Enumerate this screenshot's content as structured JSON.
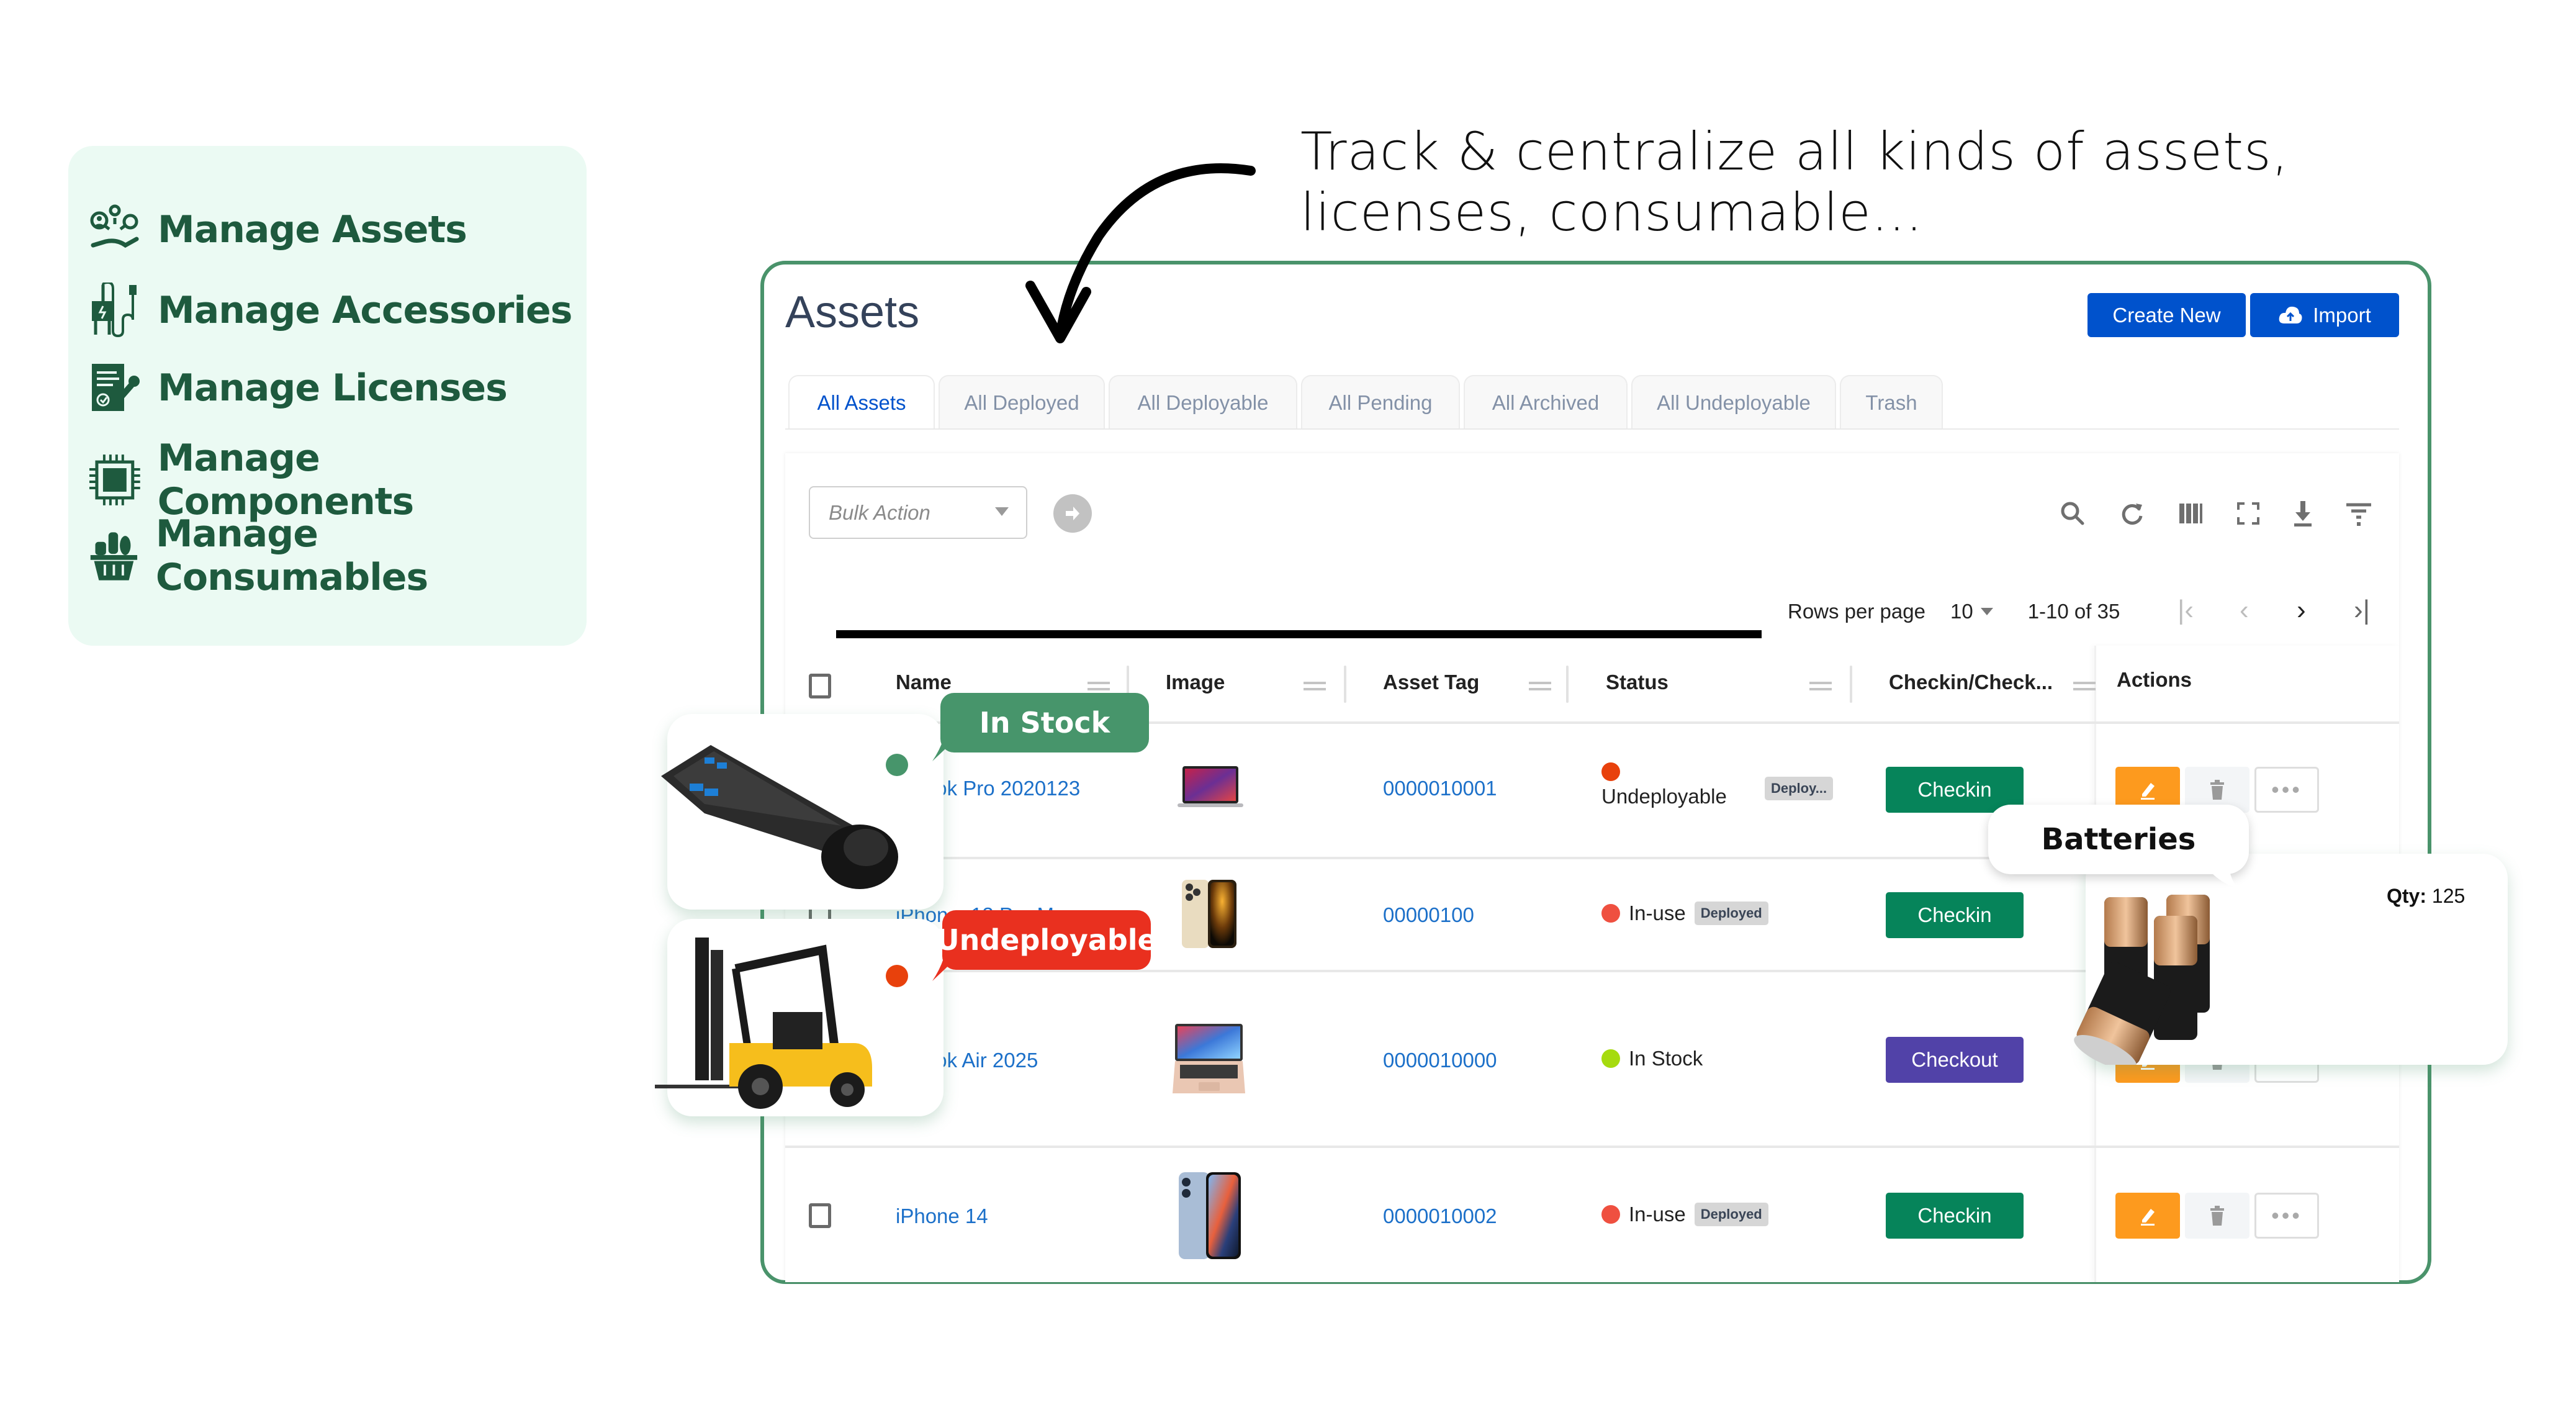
{
  "features": {
    "items": [
      {
        "icon": "hand-assets-icon",
        "label": "Manage Assets"
      },
      {
        "icon": "charger-icon",
        "label": "Manage Accessories"
      },
      {
        "icon": "license-document-icon",
        "label": "Manage Licenses"
      },
      {
        "icon": "chip-icon",
        "label": "Manage Components"
      },
      {
        "icon": "basket-icon",
        "label": "Manage Consumables"
      }
    ]
  },
  "tagline": {
    "line1": "Track & centralize all kinds of assets,",
    "line2": "licenses, consumable..."
  },
  "page": {
    "title": "Assets",
    "create_label": "Create New",
    "import_label": "Import"
  },
  "tabs": [
    {
      "label": "All Assets",
      "active": true
    },
    {
      "label": "All Deployed",
      "active": false
    },
    {
      "label": "All Deployable",
      "active": false
    },
    {
      "label": "All Pending",
      "active": false
    },
    {
      "label": "All Archived",
      "active": false
    },
    {
      "label": "All Undeployable",
      "active": false
    },
    {
      "label": "Trash",
      "active": false
    }
  ],
  "toolbar": {
    "bulk_placeholder": "Bulk Action",
    "icons": [
      "search-icon",
      "refresh-icon",
      "columns-icon",
      "fullscreen-icon",
      "download-icon",
      "filter-icon"
    ]
  },
  "pagination": {
    "rows_per_page_label": "Rows per page",
    "rows_per_page": "10",
    "range": "1-10 of 35"
  },
  "table": {
    "columns": [
      "Name",
      "Image",
      "Asset Tag",
      "Status",
      "Checkin/Check...",
      "Actions"
    ],
    "rows": [
      {
        "name": "...book Pro 2020123",
        "image": "macbook-pro-image",
        "asset_tag": "0000010001",
        "status": "Undeployable",
        "status_color": "#e8410c",
        "badge": "Deploy...",
        "action": "Checkin",
        "action_color": "#06845a"
      },
      {
        "name": "iPhon... 13 Pro M...",
        "image": "iphone-pro-gold-image",
        "asset_tag": "00000100",
        "status": "In-use",
        "status_color": "#ef5040",
        "badge": "Deployed",
        "action": "Checkin",
        "action_color": "#06845a"
      },
      {
        "name": "...book Air 2025",
        "image": "macbook-air-image",
        "asset_tag": "0000010000",
        "status": "In Stock",
        "status_color": "#a6db0f",
        "badge": "",
        "action": "Checkout",
        "action_color": "#5142a8"
      },
      {
        "name": "iPhone 14",
        "image": "iphone-blue-image",
        "asset_tag": "0000010002",
        "status": "In-use",
        "status_color": "#ef5040",
        "badge": "Deployed",
        "action": "Checkin",
        "action_color": "#06845a"
      }
    ]
  },
  "callouts": {
    "in_stock": {
      "label": "In Stock",
      "color": "#47956b",
      "item": "keyboard-mouse"
    },
    "undeployable": {
      "label": "Undeployable",
      "color": "#e9301f",
      "item": "forklift"
    },
    "batteries": {
      "label": "Batteries",
      "qty_label": "Qty:",
      "qty": "125"
    }
  },
  "colors": {
    "brand_green": "#4a936b",
    "primary_blue": "#0052cc",
    "edit_orange": "#fd9a1e",
    "sidebar_bg": "#ebfaf3",
    "sidebar_text": "#1e5a3e"
  }
}
